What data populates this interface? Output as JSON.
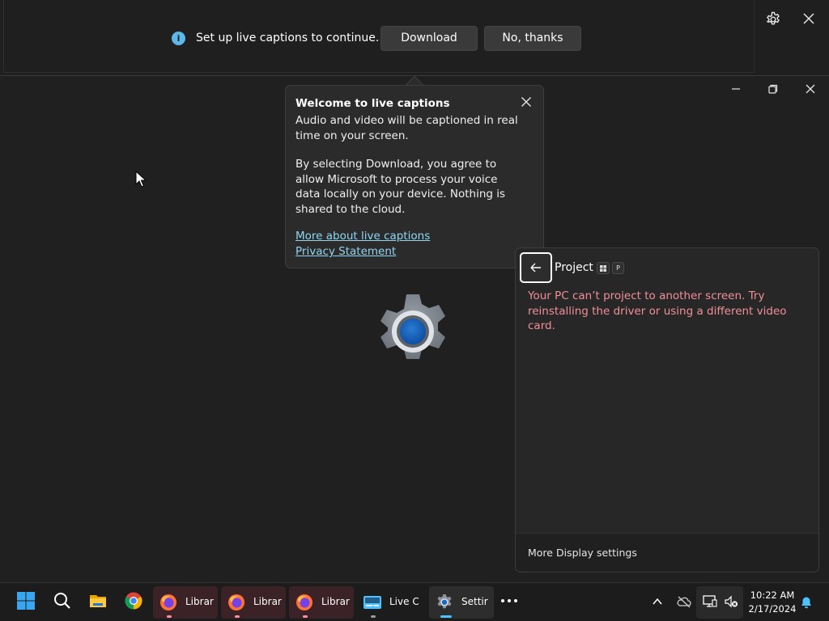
{
  "live_captions": {
    "message": "Set up live captions to continue.",
    "download_label": "Download",
    "no_thanks_label": "No, thanks"
  },
  "flyout": {
    "title": "Welcome to live captions",
    "paragraph1": "Audio and video will be captioned in real time on your screen.",
    "paragraph2": "By selecting Download, you agree to allow Microsoft to process your voice data locally on your device. Nothing is shared to the cloud.",
    "link_more": "More about live captions",
    "link_privacy": "Privacy Statement"
  },
  "project_panel": {
    "title": "Project",
    "shortcut_key": "P",
    "error_message": "Your PC can’t project to another screen. Try reinstalling the driver or using a different video card.",
    "footer_link": "More Display settings"
  },
  "taskbar": {
    "apps": [
      {
        "label": "Librar",
        "icon": "firefox-icon"
      },
      {
        "label": "Librar",
        "icon": "firefox-icon"
      },
      {
        "label": "Librar",
        "icon": "firefox-icon"
      },
      {
        "label": "Live C",
        "icon": "live-captions-icon"
      },
      {
        "label": "Settir",
        "icon": "settings-icon"
      }
    ],
    "clock_time": "10:22 AM",
    "clock_date": "2/17/2024"
  },
  "colors": {
    "accent": "#4cc2ff",
    "error_text": "#f08f9a",
    "link": "#8fd6f0"
  }
}
